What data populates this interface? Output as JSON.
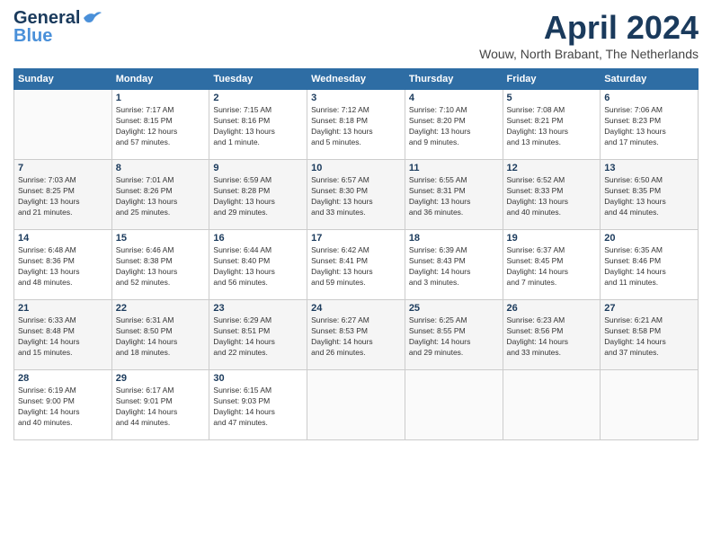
{
  "logo": {
    "line1": "General",
    "line2": "Blue"
  },
  "title": "April 2024",
  "location": "Wouw, North Brabant, The Netherlands",
  "days_header": [
    "Sunday",
    "Monday",
    "Tuesday",
    "Wednesday",
    "Thursday",
    "Friday",
    "Saturday"
  ],
  "weeks": [
    [
      {
        "day": "",
        "info": ""
      },
      {
        "day": "1",
        "info": "Sunrise: 7:17 AM\nSunset: 8:15 PM\nDaylight: 12 hours\nand 57 minutes."
      },
      {
        "day": "2",
        "info": "Sunrise: 7:15 AM\nSunset: 8:16 PM\nDaylight: 13 hours\nand 1 minute."
      },
      {
        "day": "3",
        "info": "Sunrise: 7:12 AM\nSunset: 8:18 PM\nDaylight: 13 hours\nand 5 minutes."
      },
      {
        "day": "4",
        "info": "Sunrise: 7:10 AM\nSunset: 8:20 PM\nDaylight: 13 hours\nand 9 minutes."
      },
      {
        "day": "5",
        "info": "Sunrise: 7:08 AM\nSunset: 8:21 PM\nDaylight: 13 hours\nand 13 minutes."
      },
      {
        "day": "6",
        "info": "Sunrise: 7:06 AM\nSunset: 8:23 PM\nDaylight: 13 hours\nand 17 minutes."
      }
    ],
    [
      {
        "day": "7",
        "info": "Sunrise: 7:03 AM\nSunset: 8:25 PM\nDaylight: 13 hours\nand 21 minutes."
      },
      {
        "day": "8",
        "info": "Sunrise: 7:01 AM\nSunset: 8:26 PM\nDaylight: 13 hours\nand 25 minutes."
      },
      {
        "day": "9",
        "info": "Sunrise: 6:59 AM\nSunset: 8:28 PM\nDaylight: 13 hours\nand 29 minutes."
      },
      {
        "day": "10",
        "info": "Sunrise: 6:57 AM\nSunset: 8:30 PM\nDaylight: 13 hours\nand 33 minutes."
      },
      {
        "day": "11",
        "info": "Sunrise: 6:55 AM\nSunset: 8:31 PM\nDaylight: 13 hours\nand 36 minutes."
      },
      {
        "day": "12",
        "info": "Sunrise: 6:52 AM\nSunset: 8:33 PM\nDaylight: 13 hours\nand 40 minutes."
      },
      {
        "day": "13",
        "info": "Sunrise: 6:50 AM\nSunset: 8:35 PM\nDaylight: 13 hours\nand 44 minutes."
      }
    ],
    [
      {
        "day": "14",
        "info": "Sunrise: 6:48 AM\nSunset: 8:36 PM\nDaylight: 13 hours\nand 48 minutes."
      },
      {
        "day": "15",
        "info": "Sunrise: 6:46 AM\nSunset: 8:38 PM\nDaylight: 13 hours\nand 52 minutes."
      },
      {
        "day": "16",
        "info": "Sunrise: 6:44 AM\nSunset: 8:40 PM\nDaylight: 13 hours\nand 56 minutes."
      },
      {
        "day": "17",
        "info": "Sunrise: 6:42 AM\nSunset: 8:41 PM\nDaylight: 13 hours\nand 59 minutes."
      },
      {
        "day": "18",
        "info": "Sunrise: 6:39 AM\nSunset: 8:43 PM\nDaylight: 14 hours\nand 3 minutes."
      },
      {
        "day": "19",
        "info": "Sunrise: 6:37 AM\nSunset: 8:45 PM\nDaylight: 14 hours\nand 7 minutes."
      },
      {
        "day": "20",
        "info": "Sunrise: 6:35 AM\nSunset: 8:46 PM\nDaylight: 14 hours\nand 11 minutes."
      }
    ],
    [
      {
        "day": "21",
        "info": "Sunrise: 6:33 AM\nSunset: 8:48 PM\nDaylight: 14 hours\nand 15 minutes."
      },
      {
        "day": "22",
        "info": "Sunrise: 6:31 AM\nSunset: 8:50 PM\nDaylight: 14 hours\nand 18 minutes."
      },
      {
        "day": "23",
        "info": "Sunrise: 6:29 AM\nSunset: 8:51 PM\nDaylight: 14 hours\nand 22 minutes."
      },
      {
        "day": "24",
        "info": "Sunrise: 6:27 AM\nSunset: 8:53 PM\nDaylight: 14 hours\nand 26 minutes."
      },
      {
        "day": "25",
        "info": "Sunrise: 6:25 AM\nSunset: 8:55 PM\nDaylight: 14 hours\nand 29 minutes."
      },
      {
        "day": "26",
        "info": "Sunrise: 6:23 AM\nSunset: 8:56 PM\nDaylight: 14 hours\nand 33 minutes."
      },
      {
        "day": "27",
        "info": "Sunrise: 6:21 AM\nSunset: 8:58 PM\nDaylight: 14 hours\nand 37 minutes."
      }
    ],
    [
      {
        "day": "28",
        "info": "Sunrise: 6:19 AM\nSunset: 9:00 PM\nDaylight: 14 hours\nand 40 minutes."
      },
      {
        "day": "29",
        "info": "Sunrise: 6:17 AM\nSunset: 9:01 PM\nDaylight: 14 hours\nand 44 minutes."
      },
      {
        "day": "30",
        "info": "Sunrise: 6:15 AM\nSunset: 9:03 PM\nDaylight: 14 hours\nand 47 minutes."
      },
      {
        "day": "",
        "info": ""
      },
      {
        "day": "",
        "info": ""
      },
      {
        "day": "",
        "info": ""
      },
      {
        "day": "",
        "info": ""
      }
    ]
  ]
}
